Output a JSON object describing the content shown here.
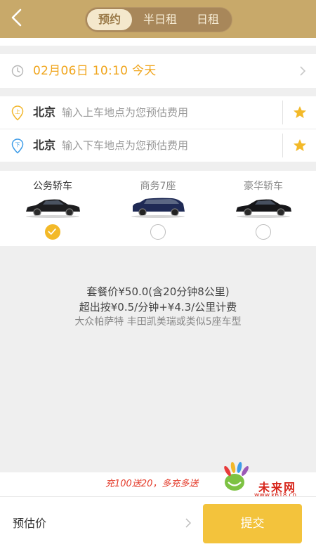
{
  "header": {
    "tabs": [
      {
        "label": "预约",
        "active": true
      },
      {
        "label": "半日租",
        "active": false
      },
      {
        "label": "日租",
        "active": false
      }
    ]
  },
  "time": {
    "text": "02月06日  10:10  今天"
  },
  "pickup": {
    "city": "北京",
    "placeholder": "输入上车地点为您预估费用",
    "icon_label": "上"
  },
  "dropoff": {
    "city": "北京",
    "placeholder": "输入下车地点为您预估费用",
    "icon_label": "下"
  },
  "car_types": [
    {
      "label": "公务轿车",
      "selected": true
    },
    {
      "label": "商务7座",
      "selected": false
    },
    {
      "label": "豪华轿车",
      "selected": false
    }
  ],
  "pricing": {
    "package": "套餐价¥50.0(含20分钟8公里)",
    "overage": "超出按¥0.5/分钟+¥4.3/公里计费",
    "models": "大众帕萨特 丰田凯美瑞或类似5座车型"
  },
  "promo": {
    "text": "充100送20，多充多送"
  },
  "watermark": {
    "title": "未来网",
    "url": "www.k618.cn"
  },
  "footer": {
    "estimate_label": "预估价",
    "submit_label": "提交"
  },
  "colors": {
    "header": "#c8a96a",
    "accent": "#f0a51c",
    "submit": "#f3c33c",
    "promo": "#e43b2a"
  }
}
